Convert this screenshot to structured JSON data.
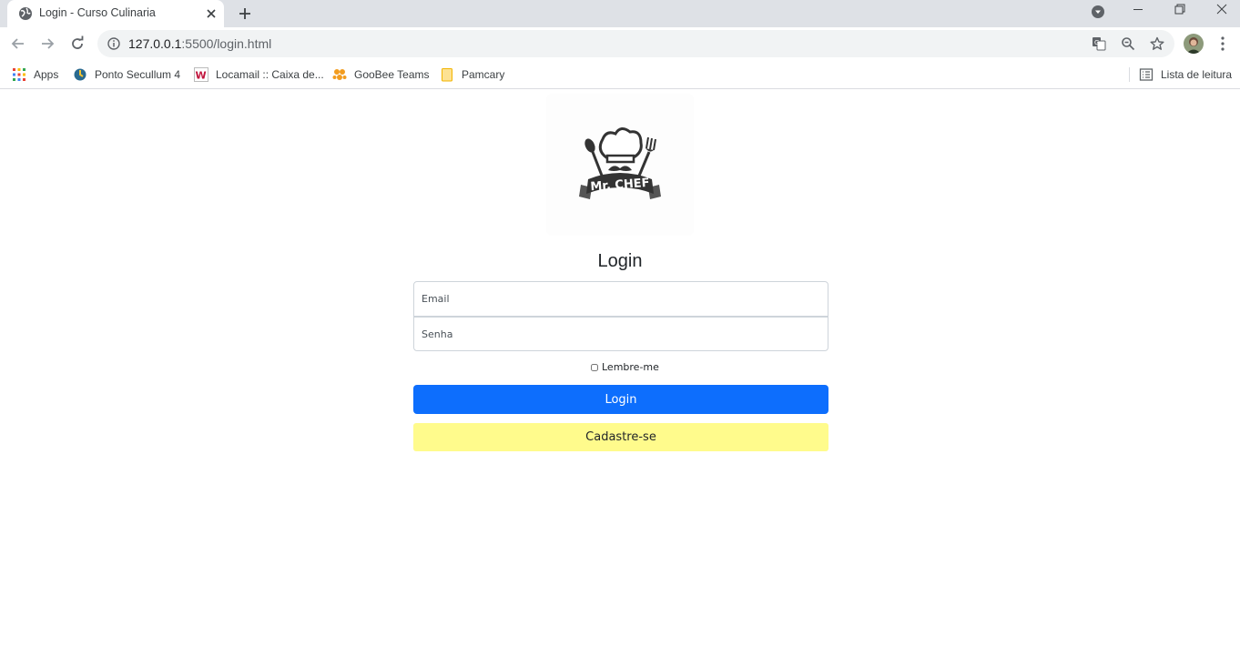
{
  "browser": {
    "tab_title": "Login - Curso Culinaria",
    "url_host": "127.0.0.1",
    "url_path": ":5500/login.html"
  },
  "bookmarks": {
    "items": [
      {
        "label": "Apps",
        "icon": "apps-grid-icon"
      },
      {
        "label": "Ponto Secullum 4",
        "icon": "secullum-icon"
      },
      {
        "label": "Locamail :: Caixa de...",
        "icon": "locamail-icon"
      },
      {
        "label": "GooBee Teams",
        "icon": "goobee-icon"
      },
      {
        "label": "Pamcary",
        "icon": "folder-icon"
      }
    ],
    "reading_list": "Lista de leitura"
  },
  "page": {
    "logo_text": "Mr. CHEF",
    "title": "Login",
    "email_placeholder": "Email",
    "password_placeholder": "Senha",
    "remember_label": "Lembre-me",
    "login_button": "Login",
    "signup_button": "Cadastre-se"
  },
  "colors": {
    "login_button": "#0d6efd",
    "signup_button": "#fffb8c",
    "tabstrip": "#dee1e6"
  }
}
